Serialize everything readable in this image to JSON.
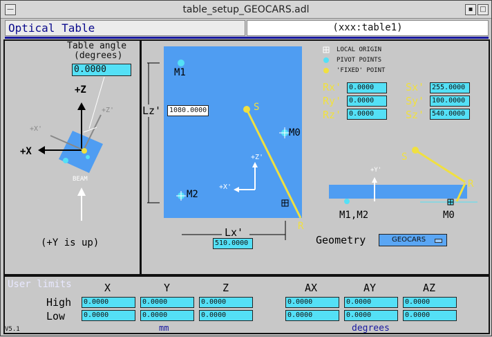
{
  "window": {
    "title": "table_setup_GEOCARS.adl"
  },
  "header": {
    "title": "Optical Table",
    "prefix": "(xxx:table1)"
  },
  "left_panel": {
    "angle_label_1": "Table angle",
    "angle_label_2": "(degrees)",
    "angle_value": "0.0000",
    "axis_z": "+Z",
    "axis_x": "+X",
    "axis_x_prime": "+X'",
    "axis_z_prime": "+Z'",
    "beam": "BEAM",
    "y_note": "(+Y is up)"
  },
  "diagram": {
    "m1": "M1",
    "m2": "M2",
    "m0": "M0",
    "s": "S",
    "r": "R",
    "lz_label": "Lz'",
    "lz_value": "1080.0000",
    "lx_label": "Lx'",
    "lx_value": "510.0000",
    "z_prime": "+Z'",
    "x_prime": "+X'"
  },
  "legend": {
    "local_origin": "LOCAL ORIGIN",
    "pivot_points": "PIVOT POINTS",
    "fixed_point": "'FIXED' POINT"
  },
  "params": {
    "rx_label": "Rx'",
    "rx_value": "0.0000",
    "ry_label": "Ry'",
    "ry_value": "0.0000",
    "rz_label": "Rz'",
    "rz_value": "0.0000",
    "sx_label": "Sx'",
    "sx_value": "255.0000",
    "sy_label": "Sy'",
    "sy_value": "100.0000",
    "sz_label": "Sz'",
    "sz_value": "540.0000"
  },
  "side_view": {
    "s": "S",
    "r": "R",
    "y_prime": "+Y'",
    "m1m2": "M1,M2",
    "m0": "M0"
  },
  "geometry": {
    "label": "Geometry",
    "selected": "GEOCARS"
  },
  "limits": {
    "title": "User limits",
    "cols": [
      "X",
      "Y",
      "Z",
      "AX",
      "AY",
      "AZ"
    ],
    "high_label": "High",
    "low_label": "Low",
    "high": [
      "0.0000",
      "0.0000",
      "0.0000",
      "0.0000",
      "0.0000",
      "0.0000"
    ],
    "low": [
      "0.0000",
      "0.0000",
      "0.0000",
      "0.0000",
      "0.0000",
      "0.0000"
    ],
    "unit_mm": "mm",
    "unit_deg": "degrees",
    "version": "V5.1"
  },
  "colors": {
    "cyan": "#54e0f6",
    "yellow": "#f0e040",
    "table_blue": "#4f9df2",
    "header_blue": "#1a1aa0"
  }
}
